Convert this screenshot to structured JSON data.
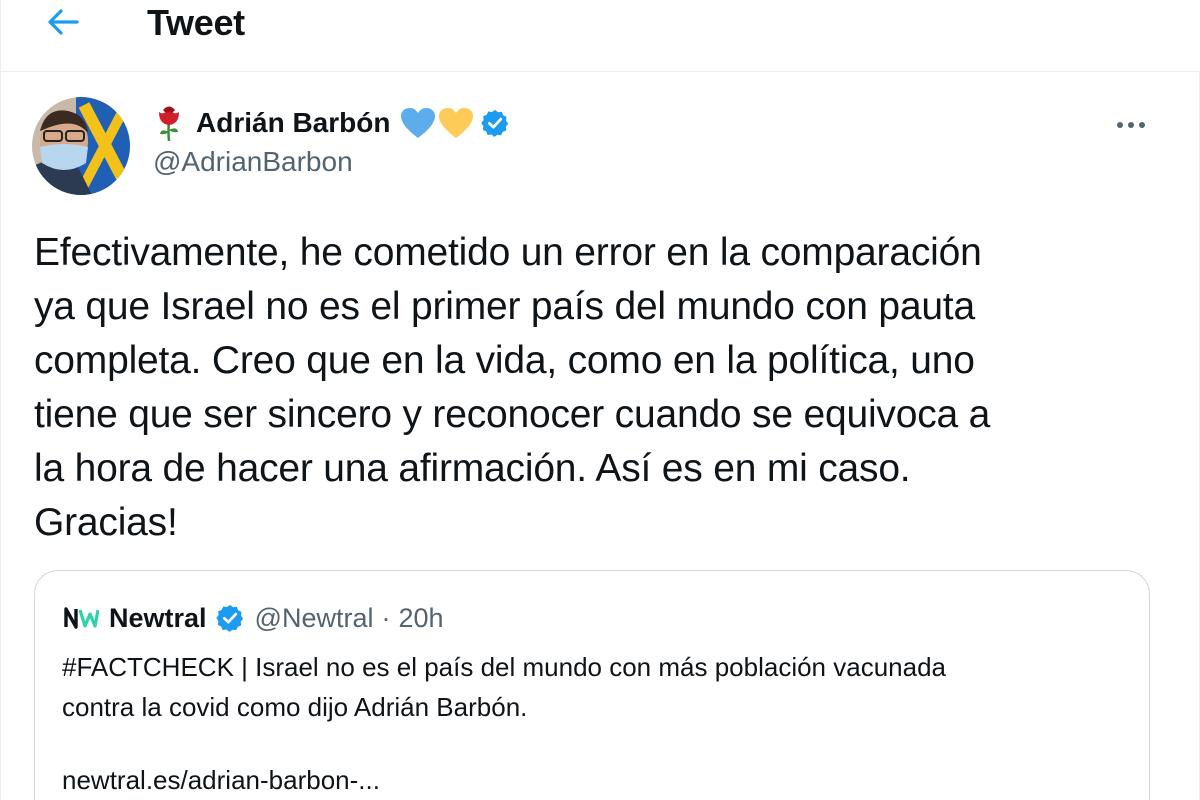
{
  "header": {
    "title": "Tweet",
    "back_icon": "arrow-left-icon",
    "accent_color": "#1d9bf0"
  },
  "tweet": {
    "author": {
      "name": "Adrián Barbón",
      "handle": "@AdrianBarbon",
      "name_emoji": [
        "rose-icon"
      ],
      "trailing_emoji": [
        "blue-heart-icon",
        "yellow-heart-icon"
      ],
      "verified": true
    },
    "more_icon": "more-horizontal-icon",
    "text_lines": [
      "Efectivamente, he cometido un error en la comparación",
      "ya que Israel no es el primer país del mundo con pauta",
      "completa. Creo que en la vida, como en la política, uno",
      "tiene que ser sincero y reconocer cuando se equivoca a",
      "la hora de hacer una afirmación. Así es en mi caso.",
      "Gracias!"
    ]
  },
  "quote": {
    "name": "Newtral",
    "handle": "@Newtral",
    "separator": "·",
    "time": "20h",
    "verified": true,
    "logo_icon": "newtral-logo-icon",
    "body_lines": [
      "#FACTCHECK | Israel no es el país del mundo con más población vacunada",
      "contra la covid como dijo Adrián Barbón."
    ],
    "link": "newtral.es/adrian-barbon-..."
  }
}
